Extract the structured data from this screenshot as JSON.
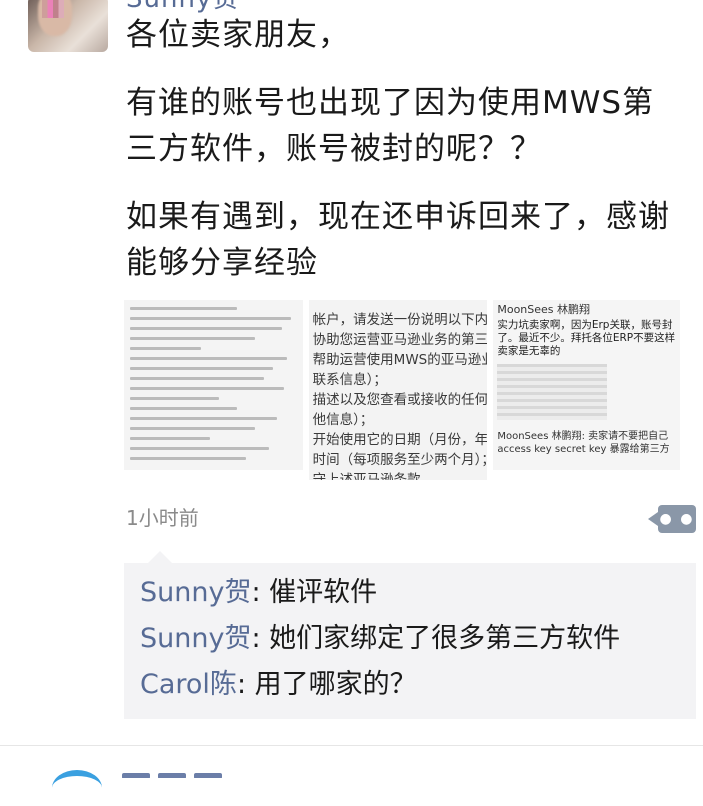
{
  "post": {
    "author": "Sunny贺",
    "paragraphs": [
      "各位卖家朋友，",
      "有谁的账号也出现了因为使用MWS第三方软件，账号被封的呢？？",
      "如果有遇到，现在还申诉回来了，感谢能够分享经验"
    ],
    "time": "1小时前"
  },
  "images": {
    "img2_lines": [
      "帐户，请发送一份说明以下内容",
      "协助您运营亚马逊业务的第三方服",
      "帮助运营使用MWS的亚马逊业务",
      "联系信息）；",
      "描述以及您查看或接收的任何信息",
      "他信息）；",
      "开始使用它的日期（月份，年份",
      "时间（每项服务至少两个月）；",
      "守上述亚马逊条款。"
    ],
    "img3_name": "MoonSees 林鹏翔",
    "img3_msg": "实力坑卖家啊，因为Erp关联，账号封了。最近不少。拜托各位ERP不要这样 卖家是无辜的",
    "img3_foot": "MoonSees 林鹏翔: 卖家请不要把自己 access key secret key 暴露给第三方"
  },
  "comments": [
    {
      "name": "Sunny贺",
      "text": ": 催评软件"
    },
    {
      "name": "Sunny贺",
      "text": ": 她们家绑定了很多第三方软件"
    },
    {
      "name": "Carol陈",
      "text": ": 用了哪家的？"
    }
  ],
  "colors": {
    "link": "#576b95",
    "comment_bg": "#f3f3f5",
    "more_btn": "#8a97a8"
  },
  "icons": {
    "more": "more-dots-icon"
  }
}
